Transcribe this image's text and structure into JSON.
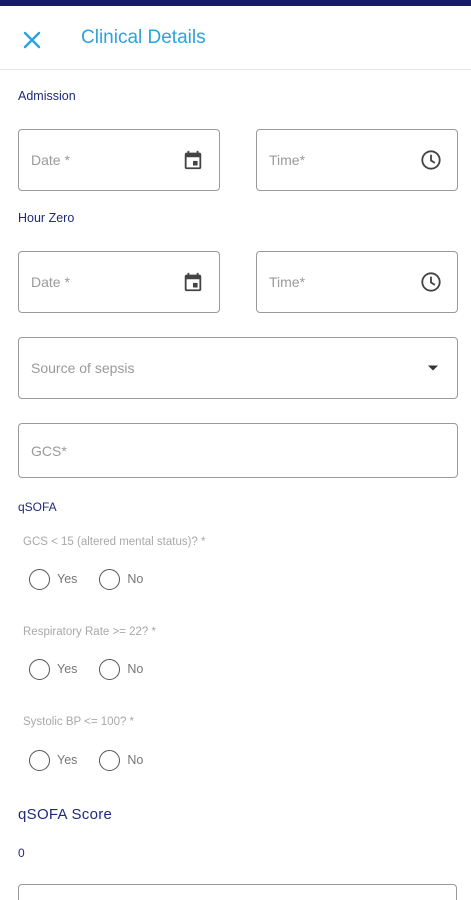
{
  "colors": {
    "accent": "#2ba3e0",
    "navy": "#1f2a7a",
    "topbar": "#141c6b"
  },
  "header": {
    "title": "Clinical Details",
    "close_icon": "close-icon"
  },
  "admission": {
    "label": "Admission",
    "date_placeholder": "Date *",
    "date_icon": "calendar-icon",
    "time_placeholder": "Time*",
    "time_icon": "clock-icon"
  },
  "hour_zero": {
    "label": "Hour Zero",
    "date_placeholder": "Date *",
    "date_icon": "calendar-icon",
    "time_placeholder": "Time*",
    "time_icon": "clock-icon"
  },
  "source_of_sepsis": {
    "placeholder": "Source of sepsis",
    "icon": "dropdown-arrow-icon"
  },
  "gcs": {
    "placeholder": "GCS*"
  },
  "qsofa": {
    "label": "qSOFA",
    "questions": [
      {
        "text": "GCS < 15 (altered mental status)? *",
        "yes": "Yes",
        "no": "No"
      },
      {
        "text": "Respiratory Rate >= 22? *",
        "yes": "Yes",
        "no": "No"
      },
      {
        "text": "Systolic BP <= 100? *",
        "yes": "Yes",
        "no": "No"
      }
    ],
    "score_label": "qSOFA Score",
    "score_value": "0"
  }
}
